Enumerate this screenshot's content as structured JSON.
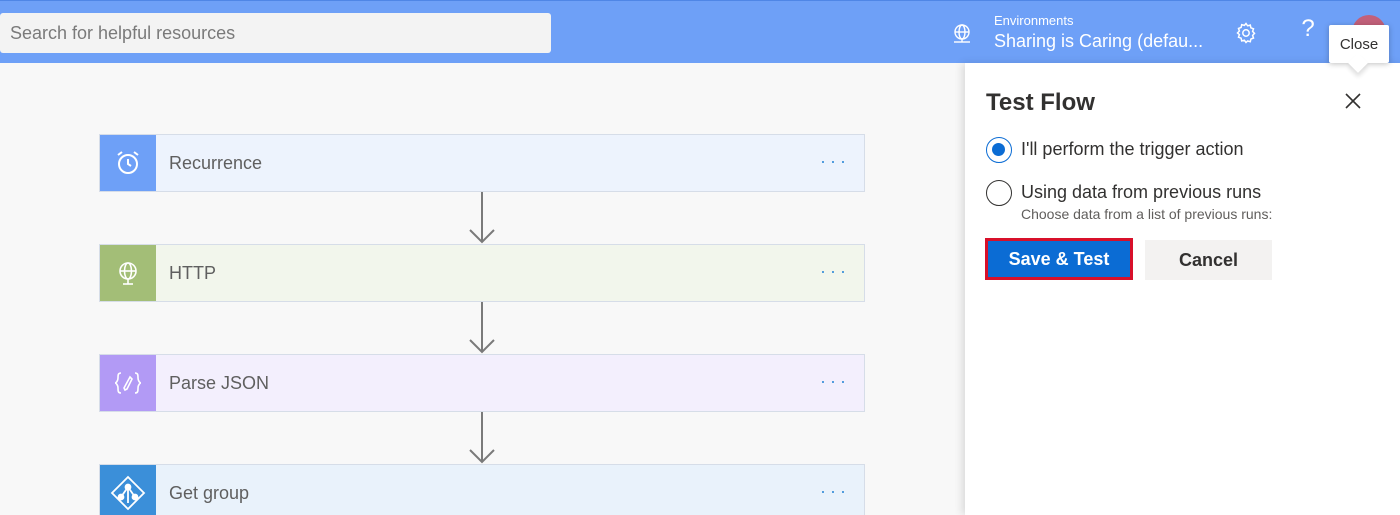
{
  "header": {
    "search_placeholder": "Search for helpful resources",
    "environments_label": "Environments",
    "environment_value": "Sharing is Caring (defau...",
    "help_label": "?"
  },
  "tooltip": {
    "text": "Close"
  },
  "flow": {
    "steps": [
      {
        "title": "Recurrence",
        "icon": "alarm-clock-icon",
        "tile_color": "#6ea0f7",
        "card_color": "#edf3fd",
        "more": "···"
      },
      {
        "title": "HTTP",
        "icon": "globe-icon",
        "tile_color": "#a3be77",
        "card_color": "#f2f6ec",
        "more": "···"
      },
      {
        "title": "Parse JSON",
        "icon": "json-braces-icon",
        "tile_color": "#b29af5",
        "card_color": "#f3effd",
        "more": "···"
      },
      {
        "title": "Get group",
        "icon": "azure-ad-icon",
        "tile_color": "#3b8fd9",
        "card_color": "#e9f2fb",
        "more": "···"
      }
    ]
  },
  "panel": {
    "title": "Test Flow",
    "options": [
      {
        "label": "I'll perform the trigger action",
        "checked": true
      },
      {
        "label": "Using data from previous runs",
        "sublabel": "Choose data from a list of previous runs:",
        "checked": false
      }
    ],
    "save_label": "Save & Test",
    "cancel_label": "Cancel"
  },
  "colors": {
    "header": "#6ea0f7",
    "accent": "#0b6cd4",
    "highlight": "#d8102a"
  }
}
